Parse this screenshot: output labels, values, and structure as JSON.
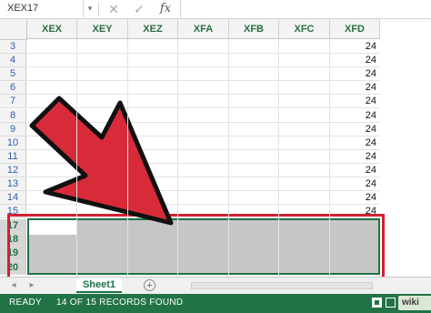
{
  "formula_bar": {
    "name_box": "XEX17",
    "name_box_arrow": "▾",
    "cancel_glyph": "✕",
    "enter_glyph": "✓",
    "fx_label": "fx",
    "formula_value": ""
  },
  "columns": [
    "XEX",
    "XEY",
    "XEZ",
    "XFA",
    "XFB",
    "XFC",
    "XFD"
  ],
  "rows": [
    {
      "label": "3",
      "value": "24"
    },
    {
      "label": "4",
      "value": "24"
    },
    {
      "label": "5",
      "value": "24"
    },
    {
      "label": "6",
      "value": "24"
    },
    {
      "label": "7",
      "value": "24"
    },
    {
      "label": "8",
      "value": "24"
    },
    {
      "label": "9",
      "value": "24"
    },
    {
      "label": "10",
      "value": "24"
    },
    {
      "label": "11",
      "value": "24"
    },
    {
      "label": "12",
      "value": "24"
    },
    {
      "label": "13",
      "value": "24"
    },
    {
      "label": "14",
      "value": "24"
    },
    {
      "label": "15",
      "value": "24"
    }
  ],
  "selected_rows": [
    "17",
    "18",
    "19",
    "20"
  ],
  "sheet_tabs": {
    "nav_left": "◂",
    "nav_right": "▸",
    "active_sheet": "Sheet1",
    "add_sheet": "+"
  },
  "status_bar": {
    "ready": "READY",
    "records": "14 OF 15 RECORDS FOUND",
    "watermark": "wiki How"
  },
  "colors": {
    "excel_green": "#217346",
    "highlight_red": "#d42032",
    "arrow_fill": "#d82b3a",
    "selection_gray": "#c6c6c6"
  },
  "icons": [
    "cancel-icon",
    "enter-icon",
    "fx-icon",
    "add-sheet-icon",
    "normal-view-icon",
    "page-layout-icon"
  ]
}
